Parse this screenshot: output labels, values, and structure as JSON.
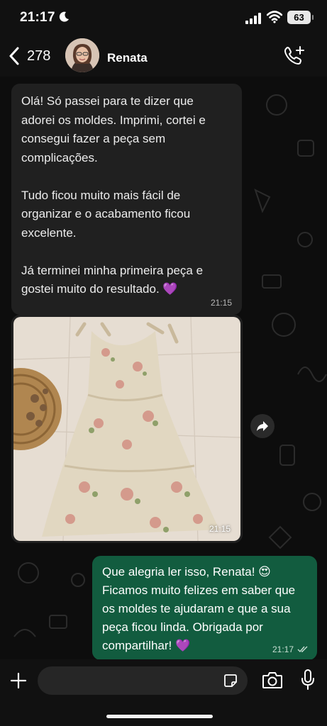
{
  "status": {
    "time": "21:17",
    "battery": "63",
    "icons": [
      "moon-icon",
      "signal-icon",
      "wifi-icon"
    ]
  },
  "header": {
    "back_count": "278",
    "contact_name": "Renata",
    "icons": [
      "chevron-left-icon",
      "avatar",
      "add-call-icon"
    ]
  },
  "messages": {
    "incoming_text": "Olá! Só passei para te dizer que\nadorei os moldes. Imprimi, cortei e\nconsegui fazer a peça sem\ncomplicações.\n\nTudo ficou muito mais fácil de\norganizar e o acabamento ficou\nexcelente.\n\nJá terminei minha primeira peça e\ngostei muito do resultado. 💜",
    "incoming_time": "21:15",
    "image_time": "21:15",
    "outgoing_text": "Que alegria ler isso, Renata! 😍 Ficamos muito felizes em saber que os moldes te ajudaram e que a sua peça ficou linda. Obrigada por compartilhar! 💜",
    "outgoing_time": "21:17"
  },
  "composer": {
    "icons": [
      "plus-icon",
      "sticker-icon",
      "camera-icon",
      "microphone-icon"
    ]
  },
  "colors": {
    "incoming_bubble": "#202020",
    "outgoing_bubble": "#125c3f",
    "background": "#0d0d0d"
  }
}
